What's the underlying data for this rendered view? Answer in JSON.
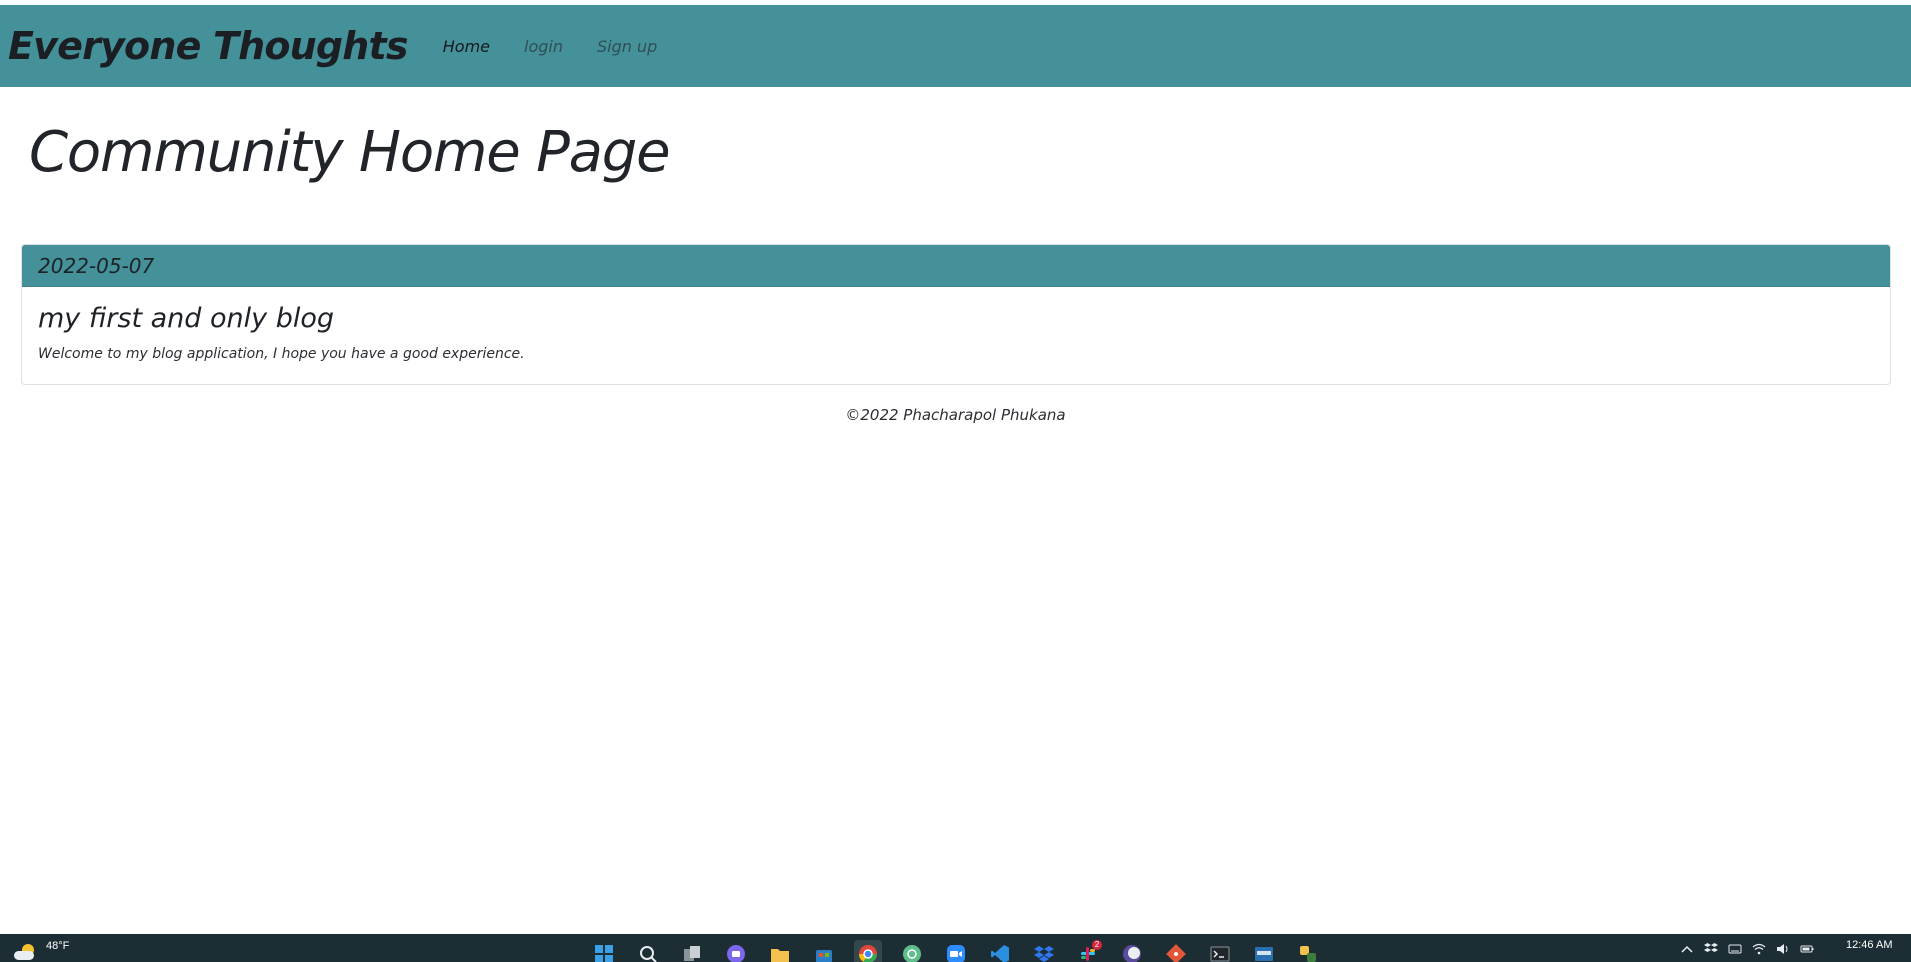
{
  "nav": {
    "brand": "Everyone Thoughts",
    "links": [
      {
        "label": "Home",
        "active": true
      },
      {
        "label": "login",
        "active": false
      },
      {
        "label": "Sign up",
        "active": false
      }
    ]
  },
  "main": {
    "title": "Community Home Page",
    "posts": [
      {
        "date": "2022-05-07",
        "title": "my first and only blog",
        "body": "Welcome to my blog application, I hope you have a good experience."
      }
    ]
  },
  "footer": {
    "text": "©2022 Phacharapol Phukana"
  },
  "taskbar": {
    "weather": {
      "temperature": "48°F",
      "icon": "partly-cloudy-icon"
    },
    "apps": [
      {
        "name": "windows-start-icon",
        "color": "#3aa0e8"
      },
      {
        "name": "search-icon",
        "color": "#e6ecef"
      },
      {
        "name": "task-view-icon",
        "color": "#c8d0d4"
      },
      {
        "name": "teams-chat-icon",
        "color": "#7b68ee"
      },
      {
        "name": "file-explorer-icon",
        "color": "#f2c14e"
      },
      {
        "name": "microsoft-store-icon",
        "color": "#3aa0e8"
      },
      {
        "name": "chrome-icon",
        "color": "#e0463a",
        "active": true
      },
      {
        "name": "chatgpt-icon",
        "color": "#5fbf8a"
      },
      {
        "name": "zoom-icon",
        "color": "#2d8cff"
      },
      {
        "name": "vscode-icon",
        "color": "#2b8fe0"
      },
      {
        "name": "dropbox-icon",
        "color": "#2f76f0"
      },
      {
        "name": "slack-icon",
        "color": "#e8a93a",
        "badge": "2"
      },
      {
        "name": "eclipse-icon",
        "color": "#5b4b9e"
      },
      {
        "name": "git-icon",
        "color": "#e0573a"
      },
      {
        "name": "terminal-icon",
        "color": "#20262a"
      },
      {
        "name": "mysql-workbench-icon",
        "color": "#2a6fb0"
      },
      {
        "name": "python-idle-icon",
        "color": "#f2c14e"
      }
    ],
    "tray_icons": [
      "chevron-up-icon",
      "dropbox-tray-icon",
      "keyboard-icon",
      "wifi-icon",
      "speaker-icon",
      "battery-icon"
    ],
    "clock": "12:46 AM"
  }
}
